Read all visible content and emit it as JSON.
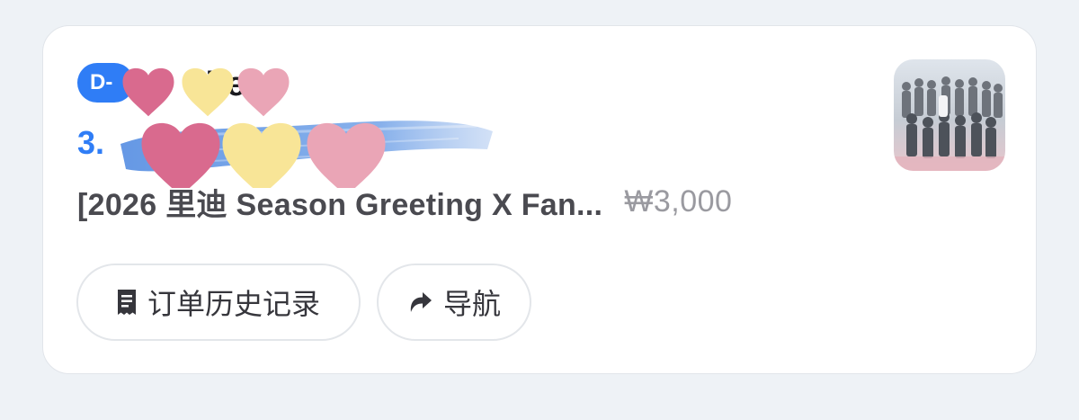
{
  "order_card": {
    "badge_label": "D-",
    "title": "jiteu",
    "line_number": "3.",
    "product_name": "[2026 里迪 Season Greeting X Fan...",
    "price": "₩3,000",
    "thumbnail_icon": "album-cover-image",
    "stickers_icon": "heart-stickers"
  },
  "actions": {
    "history": {
      "label": "订单历史记录",
      "icon": "receipt-icon"
    },
    "navigate": {
      "label": "导航",
      "icon": "share-arrow-icon"
    }
  },
  "colors": {
    "background": "#eef2f6",
    "card": "#ffffff",
    "accent": "#2f7df6",
    "heart_pink": "#d96a8e",
    "heart_yellow": "#f8e597",
    "heart_light_pink": "#eaa5b6"
  }
}
